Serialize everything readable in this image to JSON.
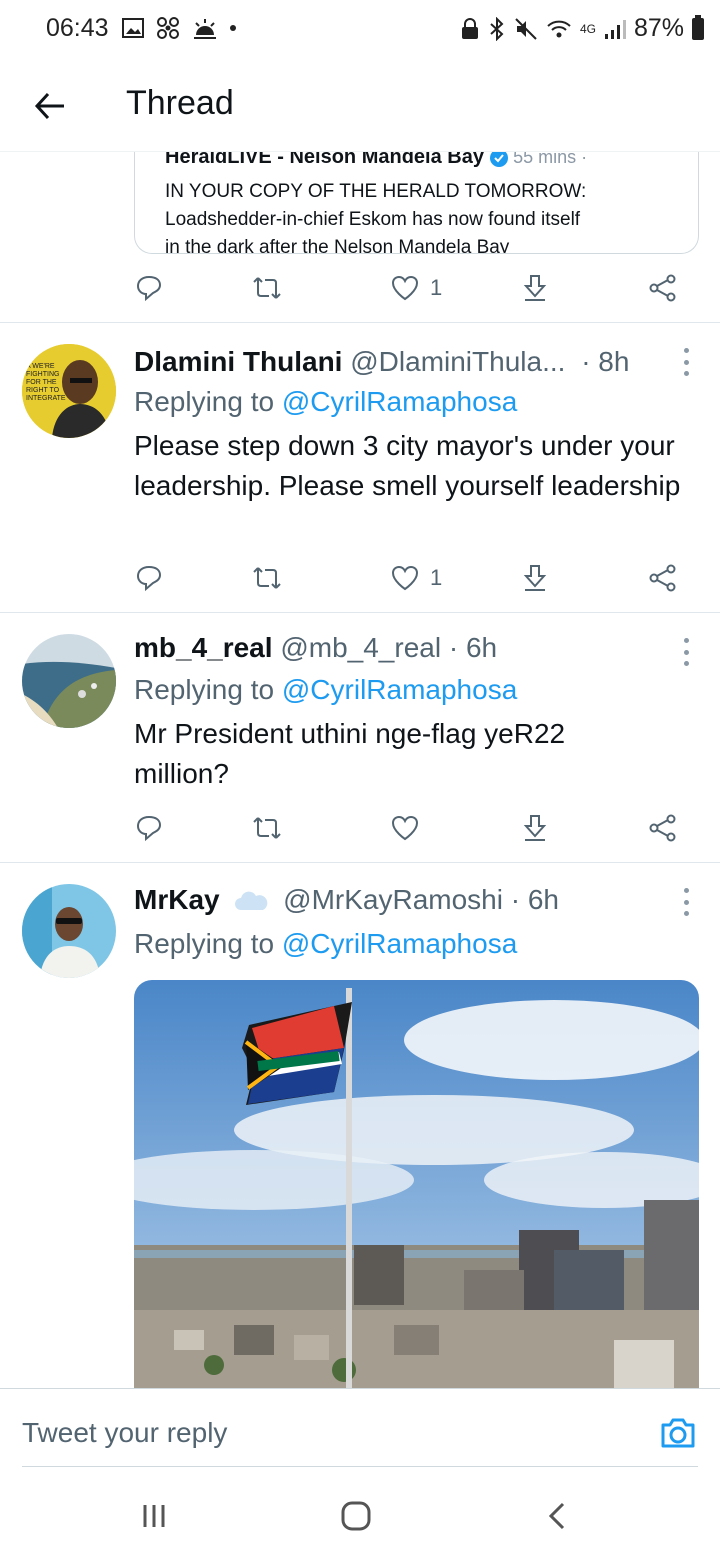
{
  "status_bar": {
    "time": "06:43",
    "network": "4G",
    "battery": "87%"
  },
  "header": {
    "title": "Thread"
  },
  "quoted_tweet": {
    "author": "HeraldLIVE - Nelson Mandela Bay",
    "time": "55 mins ·",
    "text_line1": "IN YOUR COPY OF THE HERALD TOMORROW:",
    "text_line2": "Loadshedder-in-chief Eskom has now found itself",
    "text_line3": "in the dark after the Nelson Mandela Bay"
  },
  "first_actions": {
    "likes": "1"
  },
  "tweets": [
    {
      "name": "Dlamini Thulani",
      "handle": "@DlaminiThula...",
      "time": "· 8h",
      "replying_prefix": "Replying to ",
      "replying_to": "@CyrilRamaphosa",
      "text": "Please step down 3 city mayor's under your leadership. Please smell yourself leadership",
      "likes": "1"
    },
    {
      "name": "mb_4_real",
      "handle": "@mb_4_real",
      "time": "· 6h",
      "replying_prefix": "Replying to ",
      "replying_to": "@CyrilRamaphosa",
      "text": "Mr President uthini nge-flag yeR22 million?",
      "likes": ""
    },
    {
      "name": "MrKay",
      "handle": "@MrKayRamoshi",
      "time": "· 6h",
      "replying_prefix": "Replying to ",
      "replying_to": "@CyrilRamaphosa"
    }
  ],
  "reply_bar": {
    "placeholder": "Tweet your reply"
  },
  "colors": {
    "accent": "#1d9bf0",
    "secondary_text": "#536471",
    "divider": "#e1e8ed"
  },
  "icons": [
    "back-arrow-icon",
    "reply-icon",
    "retweet-icon",
    "like-icon",
    "download-icon",
    "share-icon",
    "more-icon",
    "camera-icon"
  ]
}
